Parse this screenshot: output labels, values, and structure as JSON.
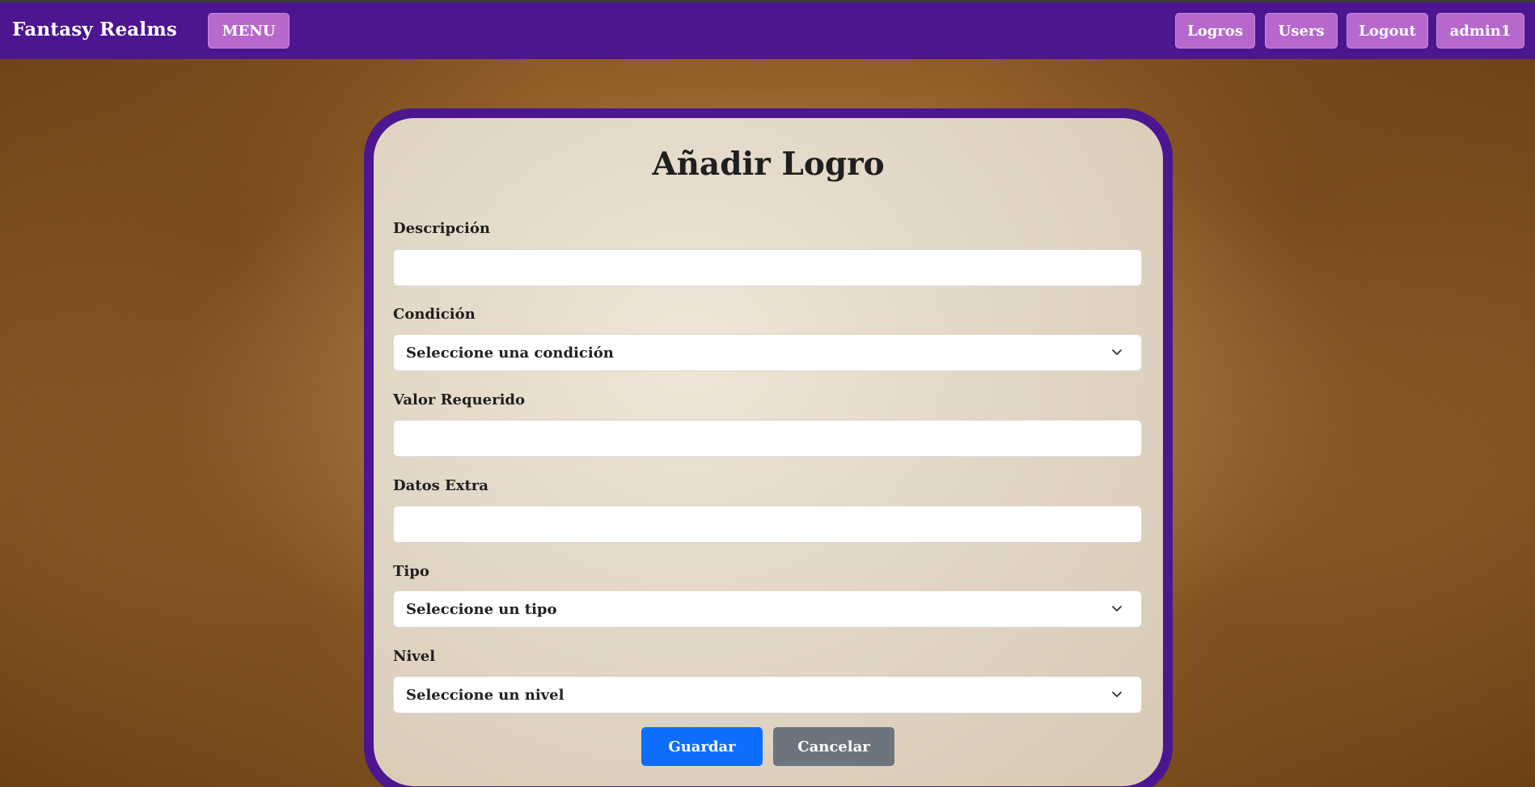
{
  "navbar": {
    "brand": "Fantasy Realms",
    "menu_label": "MENU",
    "links": {
      "logros": "Logros",
      "users": "Users",
      "logout": "Logout",
      "user": "admin1"
    }
  },
  "form": {
    "title": "Añadir Logro",
    "descripcion": {
      "label": "Descripción",
      "value": ""
    },
    "condicion": {
      "label": "Condición",
      "selected": "Seleccione una condición"
    },
    "valor_requerido": {
      "label": "Valor Requerido",
      "value": ""
    },
    "datos_extra": {
      "label": "Datos Extra",
      "value": ""
    },
    "tipo": {
      "label": "Tipo",
      "selected": "Seleccione un tipo"
    },
    "nivel": {
      "label": "Nivel",
      "selected": "Seleccione un nivel"
    },
    "save_label": "Guardar",
    "cancel_label": "Cancelar"
  },
  "colors": {
    "navbar": "#4b168f",
    "nav_button": "#b768cc",
    "primary": "#0d6efd",
    "secondary": "#6c757d"
  }
}
